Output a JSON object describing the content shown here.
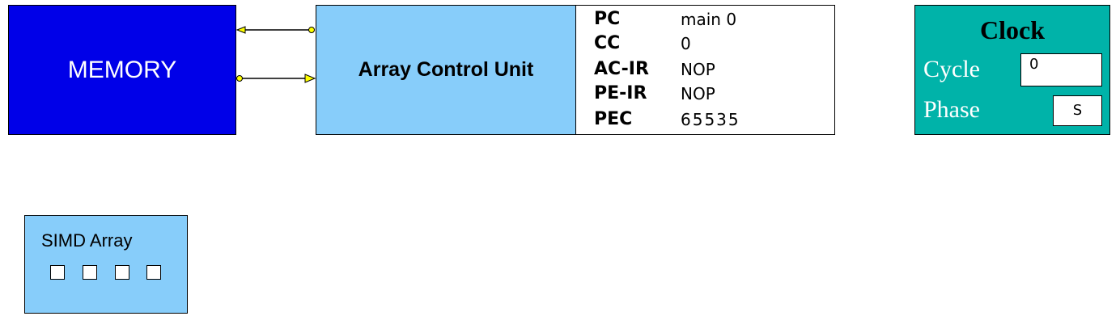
{
  "memory": {
    "label": "MEMORY"
  },
  "acu": {
    "label": "Array Control Unit"
  },
  "registers": [
    {
      "name": "PC",
      "value": "main 0"
    },
    {
      "name": "CC",
      "value": "0"
    },
    {
      "name": "AC-IR",
      "value": "NOP"
    },
    {
      "name": "PE-IR",
      "value": "NOP"
    },
    {
      "name": "PEC",
      "value": "65535"
    }
  ],
  "clock": {
    "title": "Clock",
    "cycle_label": "Cycle",
    "cycle_value": "0",
    "phase_label": "Phase",
    "phase_value": "S"
  },
  "simd": {
    "label": "SIMD Array",
    "pe_count": 4
  },
  "colors": {
    "memory": "#0000e8",
    "acu": "#87cdfa",
    "clock": "#00b3a9",
    "connector": "#ffff00"
  }
}
